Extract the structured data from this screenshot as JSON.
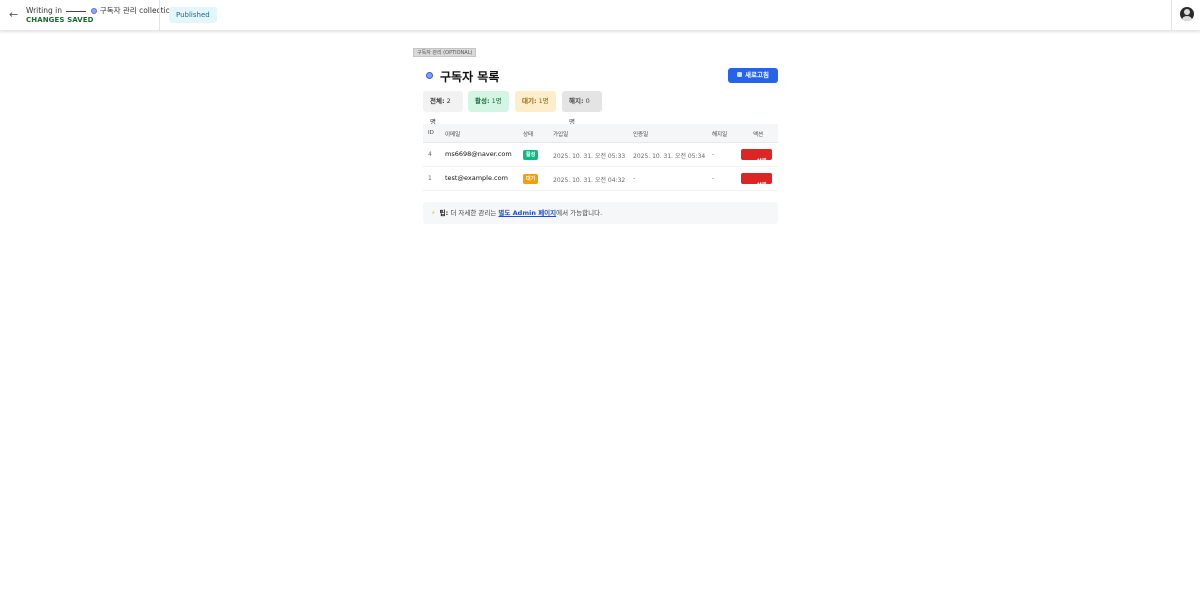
{
  "header": {
    "back_icon": "arrow-left-icon",
    "writing_in": "Writing in",
    "collection": "구독자 관리 collection",
    "save_status": "CHANGES SAVED",
    "publish_status": "Published",
    "avatar_icon": "user-avatar-icon"
  },
  "content": {
    "section_tag": "구독자 관리 (OPTIONAL)",
    "title": "구독자 목록",
    "refresh_label": "새로고침",
    "stats": {
      "all_label": "전체:",
      "all_value": "2명",
      "active_label": "활성:",
      "active_value": "1명",
      "pending_label": "대기:",
      "pending_value": "1명",
      "unsub_label": "해지:",
      "unsub_value": "0명"
    },
    "table": {
      "headers": [
        "ID",
        "이메일",
        "상태",
        "가입일",
        "인증일",
        "해지일",
        "액션"
      ],
      "rows": [
        {
          "id": "4",
          "email": "ms6698@naver.com",
          "status": "활성",
          "joined": "2025. 10. 31. 오전 05:33",
          "confirmed": "2025. 10. 31. 오전 05:34",
          "unsub": "-",
          "action": "삭제"
        },
        {
          "id": "1",
          "email": "test@example.com",
          "status": "대기",
          "joined": "2025. 10. 31. 오전 04:32",
          "confirmed": "-",
          "unsub": "-",
          "action": "삭제"
        }
      ]
    },
    "tip": {
      "label": "팁:",
      "text_before": "더 자세한 관리는",
      "link": "별도 Admin 페이지",
      "text_after": "에서 가능합니다."
    }
  },
  "colors": {
    "primary": "#2563eb",
    "active": "#10b981",
    "pending": "#f59e0b",
    "danger": "#dc2626"
  }
}
